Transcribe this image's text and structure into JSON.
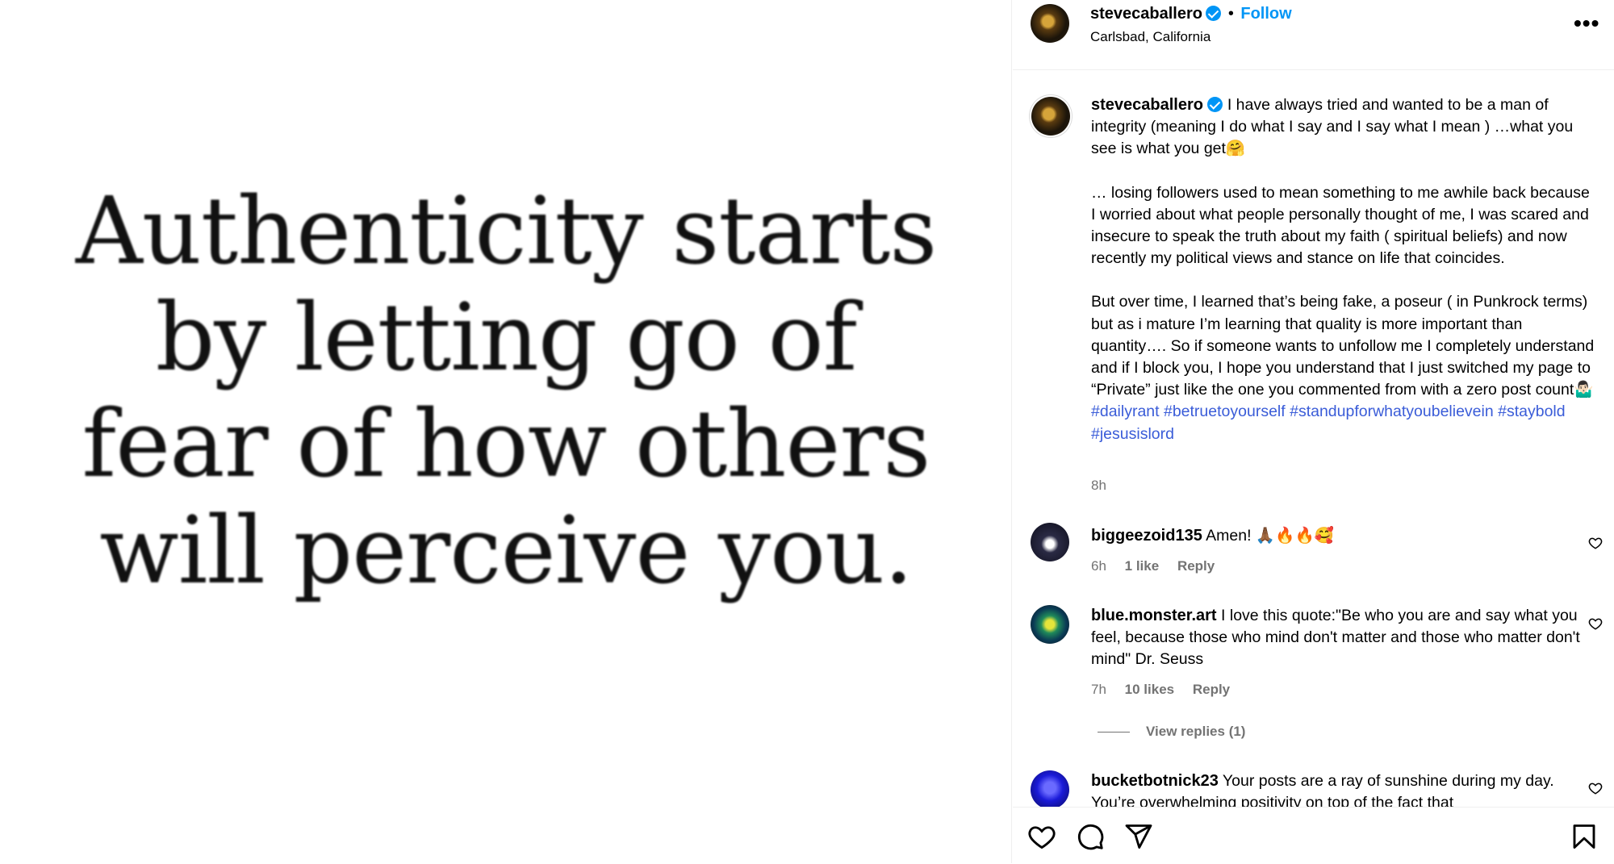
{
  "image": {
    "quote_lines": [
      "Authenticity starts",
      "by letting go of",
      "fear of how others",
      "will perceive you."
    ]
  },
  "header": {
    "username": "stevecaballero",
    "separator": "•",
    "follow_label": "Follow",
    "location": "Carlsbad, California",
    "more_icon": "more-horizontal-icon"
  },
  "caption": {
    "username": "stevecaballero",
    "para1": "I have always tried and wanted to be a man of integrity (meaning I do what I say and I say what I mean ) …what you see is what you get🤗",
    "para2": "… losing followers used to mean something to me awhile back because I worried about what people personally thought of me, I was scared and insecure to speak the truth about my faith ( spiritual beliefs) and now recently my political views and stance on life that coincides.",
    "para3": "But over time, I learned that’s being fake, a poseur ( in Punkrock terms) but as i mature I’m learning that quality is more important than quantity…. So if someone wants to unfollow me I completely understand and if I block you, I hope you understand that I just switched my page to “Private” just like the one you commented from with a zero post count🤷🏻‍♂️",
    "hashtags": [
      "#dailyrant",
      "#betruetoyourself",
      "#standupforwhatyoubelievein",
      "#staybold",
      "#jesusislord"
    ],
    "time": "8h"
  },
  "comments": [
    {
      "username": "biggeezoid135",
      "text": "Amen! 🙏🏾🔥🔥🥰",
      "time": "6h",
      "likes": "1 like",
      "reply": "Reply"
    },
    {
      "username": "blue.monster.art",
      "text": "I love this quote:\"Be who you are and say what you feel, because those who mind don't matter and those who matter don't mind\" Dr. Seuss",
      "time": "7h",
      "likes": "10 likes",
      "reply": "Reply",
      "view_replies": "View replies (1)"
    },
    {
      "username": "bucketbotnick23",
      "text": "Your posts are a ray of sunshine during my day. You’re overwhelming positivity on top of the fact that"
    }
  ],
  "actions": {
    "like_icon": "heart-icon",
    "comment_icon": "comment-icon",
    "share_icon": "share-icon",
    "save_icon": "bookmark-icon"
  },
  "colors": {
    "accent": "#0095f6",
    "hashtag": "#3a5cd8",
    "secondary_text": "#737373"
  }
}
